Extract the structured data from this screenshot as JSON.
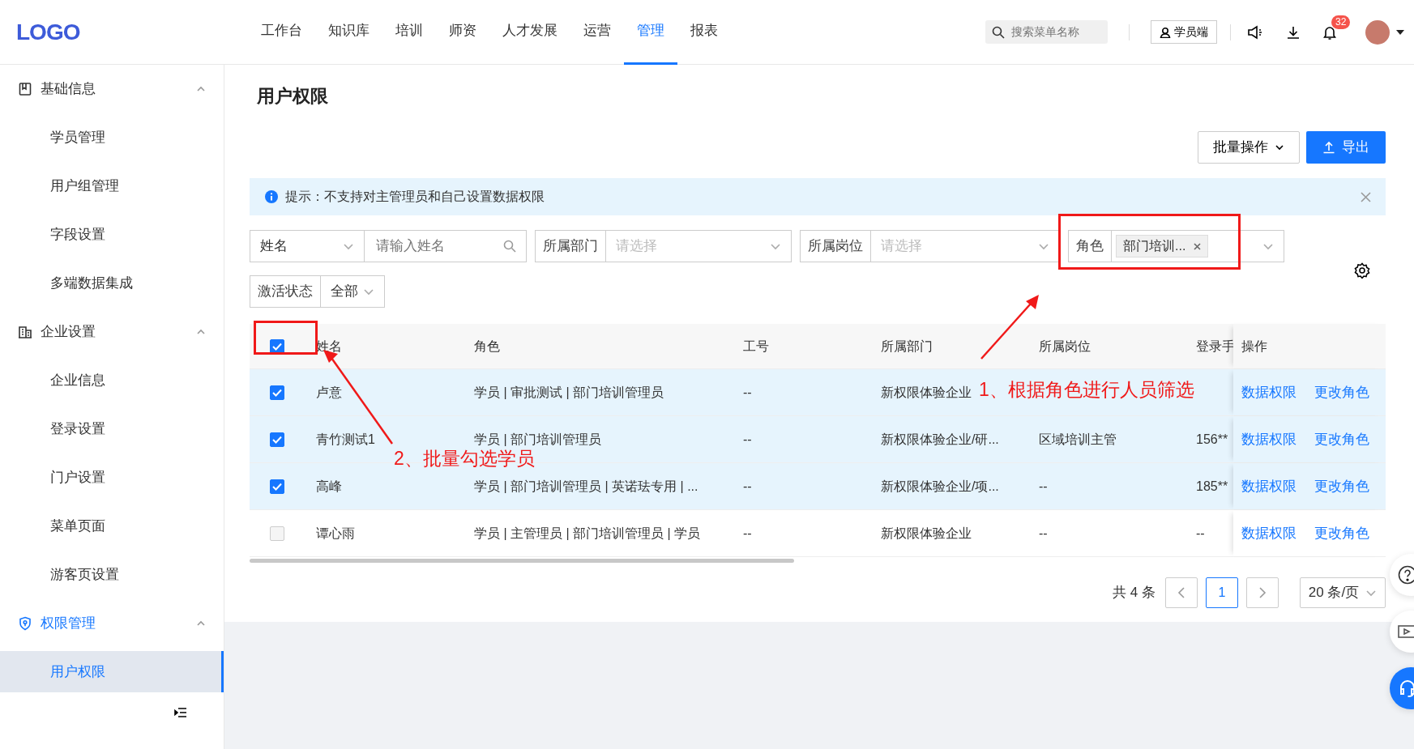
{
  "header": {
    "logo": "LOGO",
    "nav": [
      {
        "label": "工作台",
        "selected": false
      },
      {
        "label": "知识库",
        "selected": false
      },
      {
        "label": "培训",
        "selected": false
      },
      {
        "label": "师资",
        "selected": false
      },
      {
        "label": "人才发展",
        "selected": false
      },
      {
        "label": "运营",
        "selected": false
      },
      {
        "label": "管理",
        "selected": true
      },
      {
        "label": "报表",
        "selected": false
      }
    ],
    "search": {
      "placeholder": "搜索菜单名称"
    },
    "student_button": "学员端",
    "notification_count": "32"
  },
  "sidebar": {
    "groups": [
      {
        "label": "基础信息",
        "active": false,
        "expanded": true,
        "items": [
          {
            "label": "学员管理",
            "selected": false
          },
          {
            "label": "用户组管理",
            "selected": false
          },
          {
            "label": "字段设置",
            "selected": false
          },
          {
            "label": "多端数据集成",
            "selected": false
          }
        ]
      },
      {
        "label": "企业设置",
        "active": false,
        "expanded": true,
        "items": [
          {
            "label": "企业信息",
            "selected": false
          },
          {
            "label": "登录设置",
            "selected": false
          },
          {
            "label": "门户设置",
            "selected": false
          },
          {
            "label": "菜单页面",
            "selected": false
          },
          {
            "label": "游客页设置",
            "selected": false
          }
        ]
      },
      {
        "label": "权限管理",
        "active": true,
        "expanded": true,
        "items": [
          {
            "label": "用户权限",
            "selected": true
          }
        ]
      }
    ]
  },
  "page": {
    "title": "用户权限",
    "buttons": [
      {
        "kind": "dropdown",
        "label": "批量操作"
      },
      {
        "kind": "primary",
        "label": "导出"
      }
    ],
    "alert": "提示：不支持对主管理员和自己设置数据权限",
    "filters": [
      {
        "kind": "select-input",
        "select": "姓名",
        "placeholder": "请输入姓名"
      },
      {
        "kind": "select",
        "label": "所属部门",
        "placeholder": "请选择"
      },
      {
        "kind": "select",
        "label": "所属岗位",
        "placeholder": "请选择"
      },
      {
        "kind": "tags",
        "label": "角色",
        "tags": [
          "部门培训..."
        ]
      },
      {
        "kind": "value",
        "label": "激活状态",
        "value": "全部"
      }
    ],
    "table": {
      "header_checked": true,
      "columns": [
        "姓名",
        "角色",
        "工号",
        "所属部门",
        "所属岗位",
        "登录手",
        "操作"
      ],
      "rows": [
        {
          "checked": true,
          "cells": [
            "卢意",
            "学员 | 审批测试 | 部门培训管理员",
            "--",
            "新权限体验企业",
            "",
            "",
            ""
          ],
          "actions": [
            "数据权限",
            "更改角色"
          ]
        },
        {
          "checked": true,
          "cells": [
            "青竹测试1",
            "学员 | 部门培训管理员",
            "--",
            "新权限体验企业/研...",
            "区域培训主管",
            "156**"
          ],
          "actions": [
            "数据权限",
            "更改角色"
          ]
        },
        {
          "checked": true,
          "cells": [
            "高峰",
            "学员 | 部门培训管理员 | 英诺珐专用 | ...",
            "--",
            "新权限体验企业/项...",
            "--",
            "185**"
          ],
          "actions": [
            "数据权限",
            "更改角色"
          ]
        },
        {
          "checked": false,
          "cells": [
            "谭心雨",
            "学员 | 主管理员 | 部门培训管理员 | 学员",
            "--",
            "新权限体验企业",
            "--",
            "--"
          ],
          "actions": [
            "数据权限",
            "更改角色"
          ]
        }
      ]
    },
    "pagination": {
      "total": "共 4 条",
      "pages": [
        {
          "label": "1",
          "selected": true
        }
      ],
      "page_size": "20 条/页"
    }
  },
  "annotations": [
    {
      "text": "1、根据角色进行人员筛选"
    },
    {
      "text": "2、批量勾选学员"
    }
  ]
}
